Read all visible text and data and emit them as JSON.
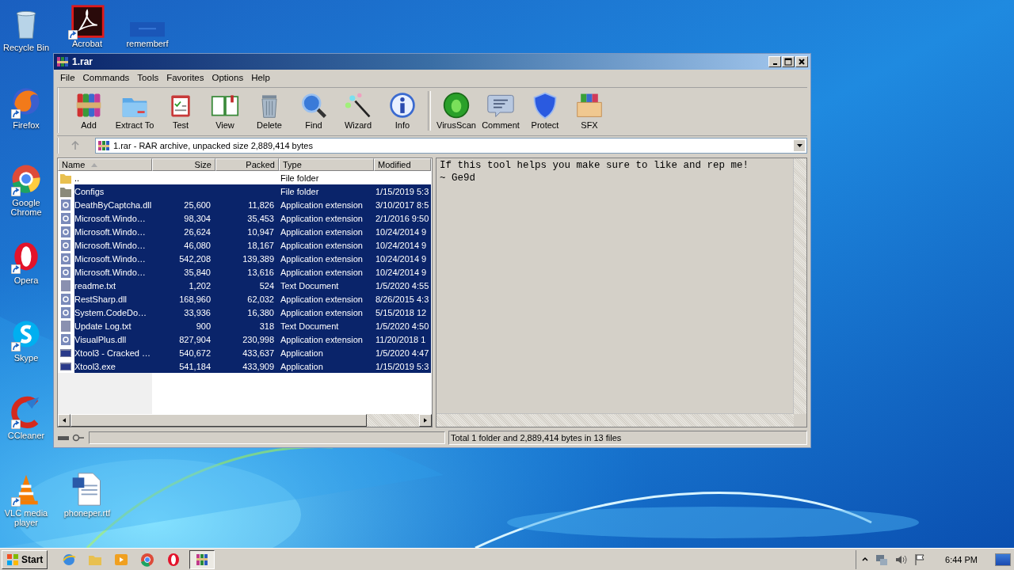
{
  "desktop_icons_left": [
    {
      "label": "Recycle Bin",
      "shortcut": false
    },
    {
      "label": "Firefox",
      "shortcut": true
    },
    {
      "label": "Google Chrome",
      "shortcut": true
    },
    {
      "label": "Opera",
      "shortcut": true
    },
    {
      "label": "Skype",
      "shortcut": true
    },
    {
      "label": "CCleaner",
      "shortcut": true
    },
    {
      "label": "VLC media player",
      "shortcut": true
    }
  ],
  "desktop_icons_top": [
    {
      "label": "Acrobat",
      "shortcut": true
    },
    {
      "label": "rememberf",
      "shortcut": false
    }
  ],
  "desktop_icons_bottom": [
    {
      "label": "phoneper.rtf",
      "shortcut": false
    }
  ],
  "window": {
    "title": "1.rar",
    "menu": [
      "File",
      "Commands",
      "Tools",
      "Favorites",
      "Options",
      "Help"
    ],
    "toolbar": [
      {
        "label": "Add"
      },
      {
        "label": "Extract To"
      },
      {
        "label": "Test"
      },
      {
        "label": "View"
      },
      {
        "label": "Delete"
      },
      {
        "label": "Find"
      },
      {
        "label": "Wizard"
      },
      {
        "label": "Info"
      },
      {
        "label": "VirusScan"
      },
      {
        "label": "Comment"
      },
      {
        "label": "Protect"
      },
      {
        "label": "SFX"
      }
    ],
    "address": "1.rar - RAR archive, unpacked size 2,889,414 bytes",
    "columns": [
      {
        "label": "Name",
        "sorted": true
      },
      {
        "label": "Size",
        "sorted": false
      },
      {
        "label": "Packed",
        "sorted": false
      },
      {
        "label": "Type",
        "sorted": false
      },
      {
        "label": "Modified",
        "sorted": false
      }
    ],
    "files": [
      {
        "kind": "up",
        "name": "..",
        "type": "File folder",
        "selected": false
      },
      {
        "kind": "folder",
        "name": "Configs",
        "type": "File folder",
        "modified": "1/15/2019 5:3",
        "selected": true
      },
      {
        "kind": "dll",
        "name": "DeathByCaptcha.dll",
        "size": "25,600",
        "packed": "11,826",
        "type": "Application extension",
        "modified": "3/10/2017 8:5",
        "selected": true
      },
      {
        "kind": "dll",
        "name": "Microsoft.Windo…",
        "size": "98,304",
        "packed": "35,453",
        "type": "Application extension",
        "modified": "2/1/2016 9:50",
        "selected": true
      },
      {
        "kind": "dll",
        "name": "Microsoft.Windo…",
        "size": "26,624",
        "packed": "10,947",
        "type": "Application extension",
        "modified": "10/24/2014 9",
        "selected": true
      },
      {
        "kind": "dll",
        "name": "Microsoft.Windo…",
        "size": "46,080",
        "packed": "18,167",
        "type": "Application extension",
        "modified": "10/24/2014 9",
        "selected": true
      },
      {
        "kind": "dll",
        "name": "Microsoft.Windo…",
        "size": "542,208",
        "packed": "139,389",
        "type": "Application extension",
        "modified": "10/24/2014 9",
        "selected": true
      },
      {
        "kind": "dll",
        "name": "Microsoft.Windo…",
        "size": "35,840",
        "packed": "13,616",
        "type": "Application extension",
        "modified": "10/24/2014 9",
        "selected": true
      },
      {
        "kind": "txt",
        "name": "readme.txt",
        "size": "1,202",
        "packed": "524",
        "type": "Text Document",
        "modified": "1/5/2020 4:55",
        "selected": true
      },
      {
        "kind": "dll",
        "name": "RestSharp.dll",
        "size": "168,960",
        "packed": "62,032",
        "type": "Application extension",
        "modified": "8/26/2015 4:3",
        "selected": true
      },
      {
        "kind": "dll",
        "name": "System.CodeDo…",
        "size": "33,936",
        "packed": "16,380",
        "type": "Application extension",
        "modified": "5/15/2018 12",
        "selected": true
      },
      {
        "kind": "txt",
        "name": "Update Log.txt",
        "size": "900",
        "packed": "318",
        "type": "Text Document",
        "modified": "1/5/2020 4:50",
        "selected": true
      },
      {
        "kind": "dll",
        "name": "VisualPlus.dll",
        "size": "827,904",
        "packed": "230,998",
        "type": "Application extension",
        "modified": "11/20/2018 1",
        "selected": true
      },
      {
        "kind": "exe",
        "name": "Xtool3 - Cracked …",
        "size": "540,672",
        "packed": "433,637",
        "type": "Application",
        "modified": "1/5/2020 4:47",
        "selected": true
      },
      {
        "kind": "exe",
        "name": "Xtool3.exe",
        "size": "541,184",
        "packed": "433,909",
        "type": "Application",
        "modified": "1/15/2019 5:3",
        "selected": true
      }
    ],
    "comment": [
      "If this tool helps you make sure to like and rep me!",
      "~ Ge9d"
    ],
    "status": "Total 1 folder and 2,889,414 bytes in 13 files"
  },
  "taskbar": {
    "start": "Start",
    "apps": [
      {
        "active": false
      },
      {
        "active": false
      },
      {
        "active": false
      },
      {
        "active": false
      },
      {
        "active": false
      },
      {
        "active": true
      }
    ],
    "clock": "6:44 PM"
  }
}
